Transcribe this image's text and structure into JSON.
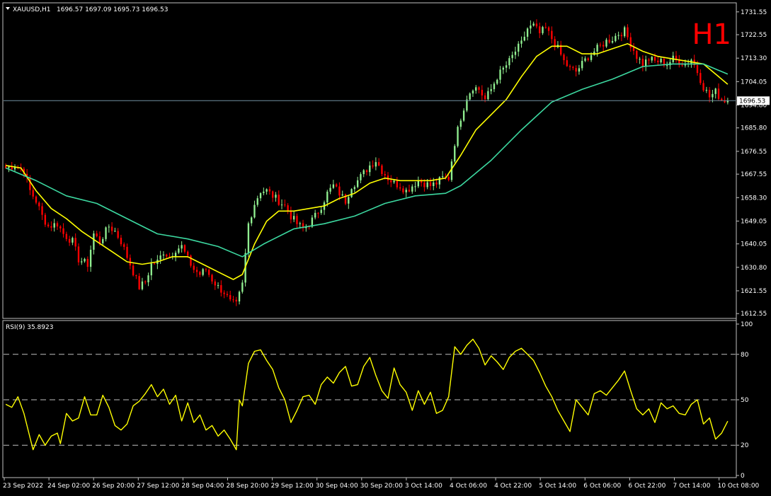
{
  "symbol_header": {
    "symbol": "XAUUSD,H1",
    "ohlc": "1696.57 1697.09 1695.73 1696.53"
  },
  "timeframe_badge": "H1",
  "current_price_label": "1696.53",
  "colors": {
    "background": "#000000",
    "frame": "#c0c0c0",
    "bull_candle": "#90ee90",
    "bear_candle": "#ff0000",
    "ma_fast": "#ffff00",
    "ma_slow": "#3cd8a0",
    "rsi_line": "#ffff00",
    "badge": "#ff0000",
    "price_line": "#7090a0",
    "text": "#ffffff"
  },
  "chart_data": [
    {
      "type": "candlestick",
      "symbol": "XAUUSD",
      "timeframe": "H1",
      "y_ticks": [
        "1731.55",
        "1722.55",
        "1713.30",
        "1704.05",
        "1694.80",
        "1685.80",
        "1676.55",
        "1667.55",
        "1658.30",
        "1649.05",
        "1640.05",
        "1630.80",
        "1621.55",
        "1612.55"
      ],
      "ylim": [
        1611.5,
        1734.0
      ],
      "x_ticks": [
        "23 Sep 2022",
        "24 Sep 02:00",
        "26 Sep 20:00",
        "27 Sep 12:00",
        "28 Sep 04:00",
        "28 Sep 20:00",
        "29 Sep 12:00",
        "30 Sep 04:00",
        "30 Sep 20:00",
        "3 Oct 14:00",
        "4 Oct 06:00",
        "4 Oct 22:00",
        "5 Oct 14:00",
        "6 Oct 06:00",
        "6 Oct 22:00",
        "7 Oct 14:00",
        "10 Oct 08:00"
      ],
      "last_close": 1696.53,
      "close_anchors": [
        [
          0,
          1670
        ],
        [
          3,
          1671
        ],
        [
          6,
          1669
        ],
        [
          8,
          1661
        ],
        [
          10,
          1657
        ],
        [
          12,
          1651
        ],
        [
          14,
          1647
        ],
        [
          17,
          1648
        ],
        [
          19,
          1644
        ],
        [
          22,
          1641
        ],
        [
          24,
          1634
        ],
        [
          27,
          1632
        ],
        [
          29,
          1644
        ],
        [
          31,
          1641
        ],
        [
          34,
          1647
        ],
        [
          36,
          1645
        ],
        [
          38,
          1641
        ],
        [
          40,
          1635
        ],
        [
          42,
          1629
        ],
        [
          44,
          1623
        ],
        [
          46,
          1625
        ],
        [
          48,
          1632
        ],
        [
          50,
          1633
        ],
        [
          52,
          1637
        ],
        [
          54,
          1635
        ],
        [
          56,
          1638
        ],
        [
          58,
          1639
        ],
        [
          60,
          1634
        ],
        [
          62,
          1630
        ],
        [
          64,
          1628
        ],
        [
          66,
          1630
        ],
        [
          68,
          1626
        ],
        [
          70,
          1623
        ],
        [
          72,
          1621
        ],
        [
          74,
          1617
        ],
        [
          76,
          1616
        ],
        [
          78,
          1624
        ],
        [
          80,
          1648
        ],
        [
          82,
          1656
        ],
        [
          84,
          1661
        ],
        [
          86,
          1661
        ],
        [
          88,
          1659
        ],
        [
          90,
          1657
        ],
        [
          92,
          1655
        ],
        [
          94,
          1651
        ],
        [
          96,
          1648
        ],
        [
          98,
          1646
        ],
        [
          100,
          1648
        ],
        [
          102,
          1651
        ],
        [
          104,
          1655
        ],
        [
          106,
          1660
        ],
        [
          108,
          1663
        ],
        [
          110,
          1660
        ],
        [
          112,
          1657
        ],
        [
          114,
          1663
        ],
        [
          116,
          1665
        ],
        [
          118,
          1668
        ],
        [
          120,
          1671
        ],
        [
          122,
          1673
        ],
        [
          124,
          1669
        ],
        [
          126,
          1666
        ],
        [
          128,
          1664
        ],
        [
          130,
          1663
        ],
        [
          132,
          1661
        ],
        [
          134,
          1663
        ],
        [
          136,
          1665
        ],
        [
          138,
          1664
        ],
        [
          140,
          1663
        ],
        [
          142,
          1664
        ],
        [
          144,
          1666
        ],
        [
          146,
          1666
        ],
        [
          148,
          1680
        ],
        [
          150,
          1690
        ],
        [
          152,
          1698
        ],
        [
          154,
          1702
        ],
        [
          156,
          1701
        ],
        [
          158,
          1697
        ],
        [
          160,
          1701
        ],
        [
          162,
          1706
        ],
        [
          164,
          1709
        ],
        [
          166,
          1712
        ],
        [
          168,
          1716
        ],
        [
          170,
          1719
        ],
        [
          172,
          1725
        ],
        [
          174,
          1726
        ],
        [
          176,
          1723
        ],
        [
          178,
          1725
        ],
        [
          180,
          1721
        ],
        [
          182,
          1717
        ],
        [
          184,
          1712
        ],
        [
          186,
          1709
        ],
        [
          188,
          1708
        ],
        [
          190,
          1711
        ],
        [
          192,
          1714
        ],
        [
          194,
          1716
        ],
        [
          196,
          1718
        ],
        [
          198,
          1720
        ],
        [
          200,
          1721
        ],
        [
          202,
          1723
        ],
        [
          204,
          1724
        ],
        [
          206,
          1719
        ],
        [
          208,
          1714
        ],
        [
          210,
          1711
        ],
        [
          212,
          1713
        ],
        [
          214,
          1712
        ],
        [
          216,
          1712
        ],
        [
          218,
          1711
        ],
        [
          220,
          1713
        ],
        [
          222,
          1712
        ],
        [
          224,
          1711
        ],
        [
          226,
          1713
        ],
        [
          228,
          1708
        ],
        [
          230,
          1702
        ],
        [
          232,
          1698
        ],
        [
          234,
          1700
        ],
        [
          236,
          1697
        ],
        [
          238,
          1696.53
        ]
      ],
      "series": [
        {
          "name": "",
          "kind": "ma_fast",
          "values": [
            [
              0,
              1671
            ],
            [
              5,
              1670
            ],
            [
              10,
              1661
            ],
            [
              15,
              1654
            ],
            [
              20,
              1650
            ],
            [
              25,
              1645
            ],
            [
              30,
              1641
            ],
            [
              35,
              1637
            ],
            [
              40,
              1633
            ],
            [
              45,
              1632
            ],
            [
              50,
              1633
            ],
            [
              55,
              1635
            ],
            [
              60,
              1635
            ],
            [
              65,
              1632
            ],
            [
              70,
              1629
            ],
            [
              75,
              1626
            ],
            [
              78,
              1628
            ],
            [
              82,
              1640
            ],
            [
              86,
              1649
            ],
            [
              90,
              1653
            ],
            [
              95,
              1653
            ],
            [
              100,
              1654
            ],
            [
              105,
              1655
            ],
            [
              110,
              1658
            ],
            [
              115,
              1660
            ],
            [
              120,
              1664
            ],
            [
              125,
              1666
            ],
            [
              130,
              1665
            ],
            [
              135,
              1665
            ],
            [
              140,
              1665
            ],
            [
              145,
              1666
            ],
            [
              150,
              1675
            ],
            [
              155,
              1685
            ],
            [
              160,
              1691
            ],
            [
              165,
              1697
            ],
            [
              170,
              1706
            ],
            [
              175,
              1714
            ],
            [
              180,
              1718
            ],
            [
              185,
              1718
            ],
            [
              190,
              1715
            ],
            [
              195,
              1715
            ],
            [
              200,
              1717
            ],
            [
              205,
              1719
            ],
            [
              210,
              1716
            ],
            [
              215,
              1714
            ],
            [
              220,
              1713
            ],
            [
              225,
              1712
            ],
            [
              230,
              1711
            ],
            [
              235,
              1706
            ],
            [
              238,
              1703
            ]
          ]
        },
        {
          "name": "",
          "kind": "ma_slow",
          "values": [
            [
              0,
              1670
            ],
            [
              10,
              1665
            ],
            [
              20,
              1659
            ],
            [
              30,
              1656
            ],
            [
              40,
              1650
            ],
            [
              50,
              1644
            ],
            [
              60,
              1642
            ],
            [
              70,
              1639
            ],
            [
              78,
              1635
            ],
            [
              85,
              1640
            ],
            [
              95,
              1646
            ],
            [
              105,
              1648
            ],
            [
              115,
              1651
            ],
            [
              125,
              1656
            ],
            [
              135,
              1659
            ],
            [
              145,
              1660
            ],
            [
              150,
              1663
            ],
            [
              160,
              1673
            ],
            [
              170,
              1685
            ],
            [
              180,
              1696
            ],
            [
              190,
              1701
            ],
            [
              200,
              1705
            ],
            [
              210,
              1710
            ],
            [
              220,
              1711
            ],
            [
              230,
              1711
            ],
            [
              238,
              1707
            ]
          ]
        }
      ]
    },
    {
      "type": "line",
      "title": "RSI(9) 35.8923",
      "y_ticks": [
        "100",
        "80",
        "50",
        "20",
        "0"
      ],
      "ylim": [
        0,
        100
      ],
      "levels": [
        80,
        50,
        20
      ],
      "x": "candle index (same axis as price pane)",
      "values": [
        [
          0,
          47
        ],
        [
          2,
          45
        ],
        [
          4,
          52
        ],
        [
          6,
          41
        ],
        [
          8,
          25
        ],
        [
          9,
          17
        ],
        [
          11,
          27
        ],
        [
          13,
          20
        ],
        [
          15,
          26
        ],
        [
          17,
          28
        ],
        [
          18,
          21
        ],
        [
          20,
          41
        ],
        [
          22,
          36
        ],
        [
          24,
          38
        ],
        [
          26,
          52
        ],
        [
          28,
          40
        ],
        [
          30,
          40
        ],
        [
          32,
          53
        ],
        [
          34,
          45
        ],
        [
          36,
          33
        ],
        [
          38,
          30
        ],
        [
          40,
          34
        ],
        [
          42,
          46
        ],
        [
          44,
          49
        ],
        [
          46,
          54
        ],
        [
          48,
          60
        ],
        [
          50,
          52
        ],
        [
          52,
          57
        ],
        [
          54,
          47
        ],
        [
          56,
          53
        ],
        [
          58,
          36
        ],
        [
          60,
          48
        ],
        [
          62,
          35
        ],
        [
          64,
          40
        ],
        [
          66,
          30
        ],
        [
          68,
          33
        ],
        [
          70,
          26
        ],
        [
          72,
          30
        ],
        [
          74,
          24
        ],
        [
          76,
          17
        ],
        [
          77,
          50
        ],
        [
          78,
          46
        ],
        [
          80,
          74
        ],
        [
          82,
          82
        ],
        [
          84,
          83
        ],
        [
          86,
          76
        ],
        [
          88,
          70
        ],
        [
          90,
          58
        ],
        [
          92,
          50
        ],
        [
          94,
          35
        ],
        [
          96,
          43
        ],
        [
          98,
          52
        ],
        [
          100,
          53
        ],
        [
          102,
          47
        ],
        [
          104,
          60
        ],
        [
          106,
          65
        ],
        [
          108,
          61
        ],
        [
          110,
          68
        ],
        [
          112,
          72
        ],
        [
          114,
          59
        ],
        [
          116,
          60
        ],
        [
          118,
          72
        ],
        [
          120,
          78
        ],
        [
          122,
          66
        ],
        [
          124,
          56
        ],
        [
          126,
          51
        ],
        [
          128,
          71
        ],
        [
          130,
          60
        ],
        [
          132,
          55
        ],
        [
          134,
          43
        ],
        [
          136,
          56
        ],
        [
          138,
          47
        ],
        [
          140,
          55
        ],
        [
          142,
          41
        ],
        [
          144,
          43
        ],
        [
          146,
          52
        ],
        [
          148,
          85
        ],
        [
          150,
          80
        ],
        [
          152,
          86
        ],
        [
          154,
          90
        ],
        [
          156,
          84
        ],
        [
          158,
          73
        ],
        [
          160,
          79
        ],
        [
          162,
          75
        ],
        [
          164,
          70
        ],
        [
          166,
          78
        ],
        [
          168,
          82
        ],
        [
          170,
          84
        ],
        [
          172,
          80
        ],
        [
          174,
          76
        ],
        [
          176,
          68
        ],
        [
          178,
          59
        ],
        [
          180,
          52
        ],
        [
          182,
          43
        ],
        [
          184,
          36
        ],
        [
          186,
          29
        ],
        [
          188,
          50
        ],
        [
          190,
          45
        ],
        [
          192,
          40
        ],
        [
          194,
          54
        ],
        [
          196,
          56
        ],
        [
          198,
          53
        ],
        [
          200,
          58
        ],
        [
          202,
          63
        ],
        [
          204,
          69
        ],
        [
          206,
          56
        ],
        [
          208,
          44
        ],
        [
          210,
          40
        ],
        [
          212,
          44
        ],
        [
          214,
          35
        ],
        [
          216,
          48
        ],
        [
          218,
          44
        ],
        [
          220,
          46
        ],
        [
          222,
          41
        ],
        [
          224,
          40
        ],
        [
          226,
          47
        ],
        [
          228,
          50
        ],
        [
          230,
          34
        ],
        [
          232,
          38
        ],
        [
          234,
          24
        ],
        [
          236,
          28
        ],
        [
          238,
          35.89
        ]
      ]
    }
  ]
}
